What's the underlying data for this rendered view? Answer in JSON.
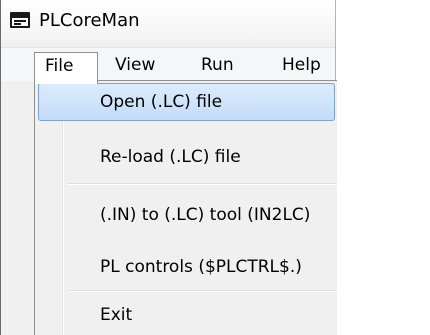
{
  "window": {
    "title": "PLCoreMan",
    "icon": "application-window-icon"
  },
  "menubar": {
    "items": [
      {
        "label": "File",
        "active": true
      },
      {
        "label": "View"
      },
      {
        "label": "Run"
      },
      {
        "label": "Help"
      }
    ]
  },
  "file_menu": {
    "items": [
      {
        "label": "Open (.LC) file",
        "highlighted": true
      },
      {
        "label": "Re-load (.LC) file"
      },
      {
        "label": "(.IN) to (.LC) tool (IN2LC)"
      },
      {
        "label": "PL controls ($PLCTRL$.)"
      },
      {
        "label": "Exit"
      }
    ]
  },
  "colors": {
    "highlight_fill": "#c3dcf8",
    "highlight_border": "#7da2ce",
    "menu_background": "#f0f0f0"
  }
}
